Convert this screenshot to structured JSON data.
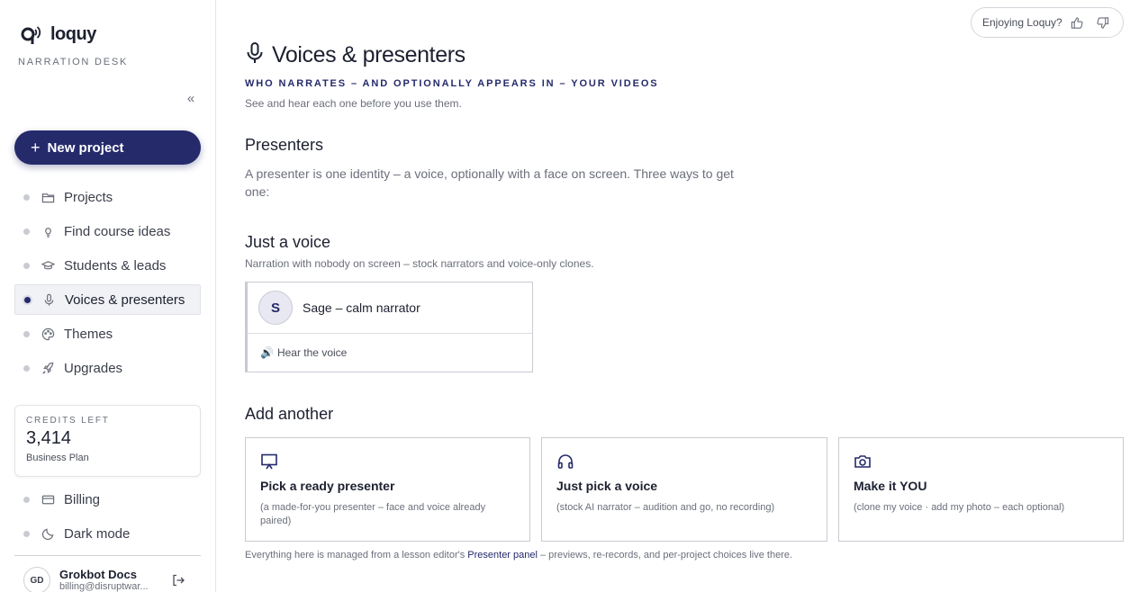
{
  "brand": {
    "name": "loquy",
    "subtitle": "NARRATION DESK"
  },
  "sidebar": {
    "collapse_glyph": "«",
    "new_project": {
      "plus": "+",
      "label": "New project"
    },
    "items": [
      {
        "label": "Projects",
        "icon": "folder-icon"
      },
      {
        "label": "Find course ideas",
        "icon": "lightbulb-icon"
      },
      {
        "label": "Students & leads",
        "icon": "graduation-cap-icon"
      },
      {
        "label": "Voices & presenters",
        "icon": "microphone-icon",
        "active": true
      },
      {
        "label": "Themes",
        "icon": "palette-icon"
      },
      {
        "label": "Upgrades",
        "icon": "rocket-icon"
      }
    ],
    "credits": {
      "label": "CREDITS LEFT",
      "value": "3,414",
      "plan": "Business Plan"
    },
    "bottom_items": [
      {
        "label": "Billing",
        "icon": "credit-card-icon"
      },
      {
        "label": "Dark mode",
        "icon": "moon-icon"
      }
    ],
    "user": {
      "initials": "GD",
      "name": "Grokbot Docs",
      "email": "billing@disruptwar..."
    }
  },
  "feedback": {
    "label": "Enjoying Loquy?"
  },
  "main": {
    "title": "Voices & presenters",
    "eyebrow": "WHO NARRATES – AND OPTIONALLY APPEARS IN – YOUR VIDEOS",
    "lede": "See and hear each one before you use them.",
    "presenters": {
      "heading": "Presenters",
      "text": "A presenter is one identity – a voice, optionally with a face on screen. Three ways to get one:"
    },
    "just_a_voice": {
      "heading": "Just a voice",
      "text": "Narration with nobody on screen – stock narrators and voice-only clones.",
      "card": {
        "initial": "S",
        "name": "Sage – calm narrator",
        "action_glyph": "🔊",
        "action": "Hear the voice"
      }
    },
    "add_another": {
      "heading": "Add another",
      "options": [
        {
          "title": "Pick a ready presenter",
          "desc": "(a made-for-you presenter – face and voice already paired)",
          "icon": "presentation-icon"
        },
        {
          "title": "Just pick a voice",
          "desc": "(stock AI narrator – audition and go, no recording)",
          "icon": "headphones-icon"
        },
        {
          "title": "Make it YOU",
          "desc": "(clone my voice · add my photo – each optional)",
          "icon": "camera-icon"
        }
      ]
    },
    "footer": {
      "before": "Everything here is managed from a lesson editor's ",
      "link": "Presenter panel",
      "after": " – previews, re-records, and per-project choices live there."
    }
  },
  "colors": {
    "accent": "#252a6b",
    "muted": "#6b6f7b",
    "border": "#c9cbd2"
  }
}
